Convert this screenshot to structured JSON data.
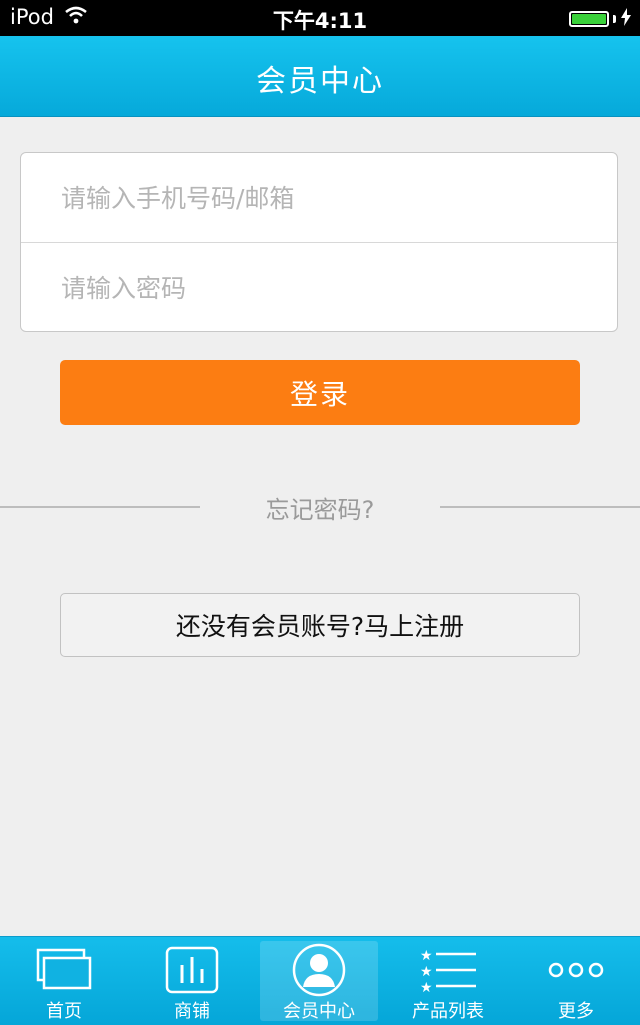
{
  "status_bar": {
    "device": "iPod",
    "time": "下午4:11"
  },
  "header": {
    "title": "会员中心"
  },
  "login_form": {
    "phone_placeholder": "请输入手机号码/邮箱",
    "password_placeholder": "请输入密码",
    "login_label": "登录",
    "forgot_label": "忘记密码?",
    "register_label": "还没有会员账号?马上注册"
  },
  "tabbar": {
    "active_index": 2,
    "items": [
      {
        "label": "首页",
        "icon": "home-icon"
      },
      {
        "label": "商铺",
        "icon": "store-icon"
      },
      {
        "label": "会员中心",
        "icon": "member-icon"
      },
      {
        "label": "产品列表",
        "icon": "product-list-icon"
      },
      {
        "label": "更多",
        "icon": "more-icon"
      }
    ]
  },
  "colors": {
    "header": "#0fb4e5",
    "login_button": "#fc7d12",
    "battery": "#3ad13a"
  }
}
